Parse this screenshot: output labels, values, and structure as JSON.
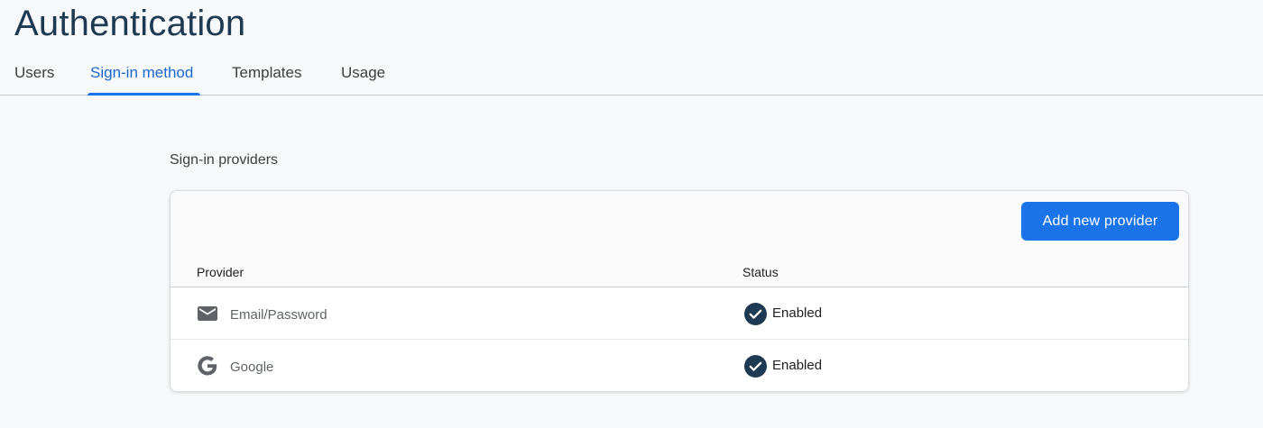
{
  "page": {
    "title": "Authentication"
  },
  "tabs": [
    {
      "label": "Users",
      "active": false
    },
    {
      "label": "Sign-in method",
      "active": true
    },
    {
      "label": "Templates",
      "active": false
    },
    {
      "label": "Usage",
      "active": false
    }
  ],
  "providers_section": {
    "title": "Sign-in providers",
    "add_button_label": "Add new provider",
    "columns": {
      "provider": "Provider",
      "status": "Status"
    },
    "rows": [
      {
        "provider": "Email/Password",
        "icon": "mail-icon",
        "status": "Enabled",
        "status_icon": "check-circle-icon"
      },
      {
        "provider": "Google",
        "icon": "google-icon",
        "status": "Enabled",
        "status_icon": "check-circle-icon"
      }
    ]
  },
  "colors": {
    "accent": "#1a73e8",
    "title": "#1e3a52",
    "status_icon": "#1e3a52",
    "background": "#f7f8fa"
  }
}
